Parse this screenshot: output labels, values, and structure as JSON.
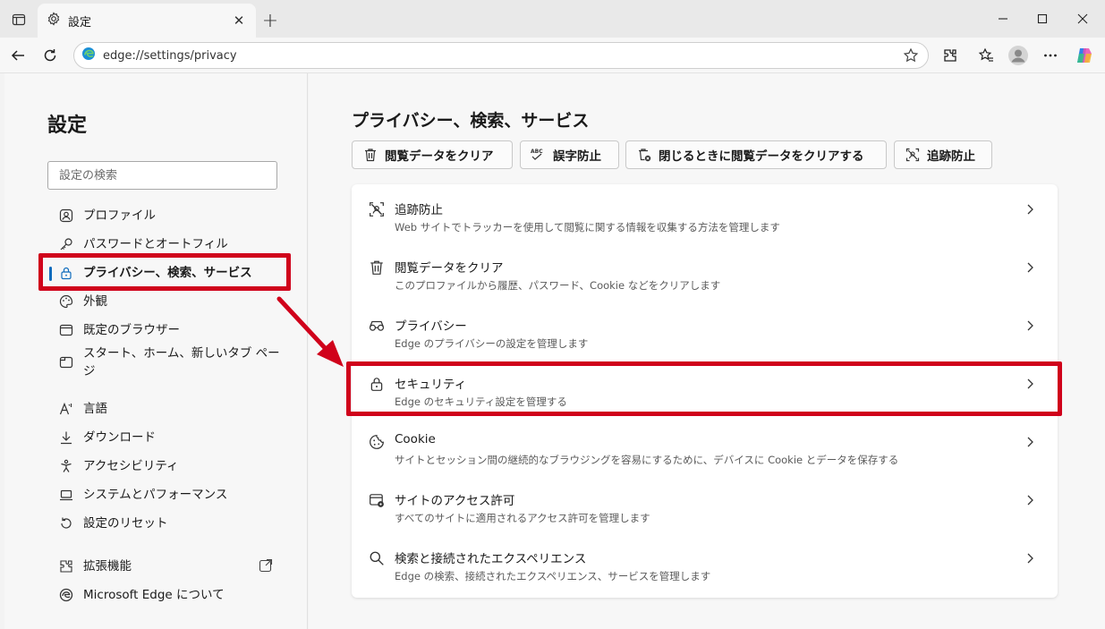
{
  "window": {
    "tab_title": "設定",
    "url": "edge://settings/privacy"
  },
  "sidebar": {
    "title": "設定",
    "search_placeholder": "設定の検索",
    "items": [
      {
        "label": "プロファイル",
        "icon": "profile-icon"
      },
      {
        "label": "パスワードとオートフィル",
        "icon": "key-icon"
      },
      {
        "label": "プライバシー、検索、サービス",
        "icon": "lock-icon",
        "active": true
      },
      {
        "label": "外観",
        "icon": "palette-icon"
      },
      {
        "label": "既定のブラウザー",
        "icon": "browser-icon"
      },
      {
        "label": "スタート、ホーム、新しいタブ ページ",
        "icon": "home-tab-icon"
      },
      {
        "label": "言語",
        "icon": "language-icon"
      },
      {
        "label": "ダウンロード",
        "icon": "download-icon"
      },
      {
        "label": "アクセシビリティ",
        "icon": "accessibility-icon"
      },
      {
        "label": "システムとパフォーマンス",
        "icon": "laptop-icon"
      },
      {
        "label": "設定のリセット",
        "icon": "reset-icon"
      },
      {
        "label": "拡張機能",
        "icon": "extensions-icon"
      },
      {
        "label": "Microsoft Edge について",
        "icon": "edge-logo-icon"
      }
    ]
  },
  "main": {
    "title": "プライバシー、検索、サービス",
    "quick_actions": [
      {
        "label": "閲覧データをクリア",
        "icon": "trash-icon"
      },
      {
        "label": "誤字防止",
        "icon": "spellcheck-icon"
      },
      {
        "label": "閉じるときに閲覧データをクリアする",
        "icon": "trash-x-icon"
      },
      {
        "label": "追跡防止",
        "icon": "tracking-icon"
      }
    ],
    "rows": [
      {
        "title": "追跡防止",
        "desc": "Web サイトでトラッカーを使用して閲覧に関する情報を収集する方法を管理します",
        "icon": "tracking-icon"
      },
      {
        "title": "閲覧データをクリア",
        "desc": "このプロファイルから履歴、パスワード、Cookie などをクリアします",
        "icon": "trash-icon"
      },
      {
        "title": "プライバシー",
        "desc": "Edge のプライバシーの設定を管理します",
        "icon": "glasses-icon"
      },
      {
        "title": "セキュリティ",
        "desc": "Edge のセキュリティ設定を管理する",
        "icon": "lock-icon"
      },
      {
        "title": "Cookie",
        "desc": "サイトとセッション間の継続的なブラウジングを容易にするために、デバイスに Cookie とデータを保存する",
        "icon": "cookie-icon"
      },
      {
        "title": "サイトのアクセス許可",
        "desc": "すべてのサイトに適用されるアクセス許可を管理します",
        "icon": "site-permissions-icon"
      },
      {
        "title": "検索と接続されたエクスペリエンス",
        "desc": "Edge の検索、接続されたエクスペリエンス、サービスを管理します",
        "icon": "search-icon"
      }
    ]
  },
  "colors": {
    "accent": "#0f6cbd",
    "annotation": "#d0021b"
  }
}
